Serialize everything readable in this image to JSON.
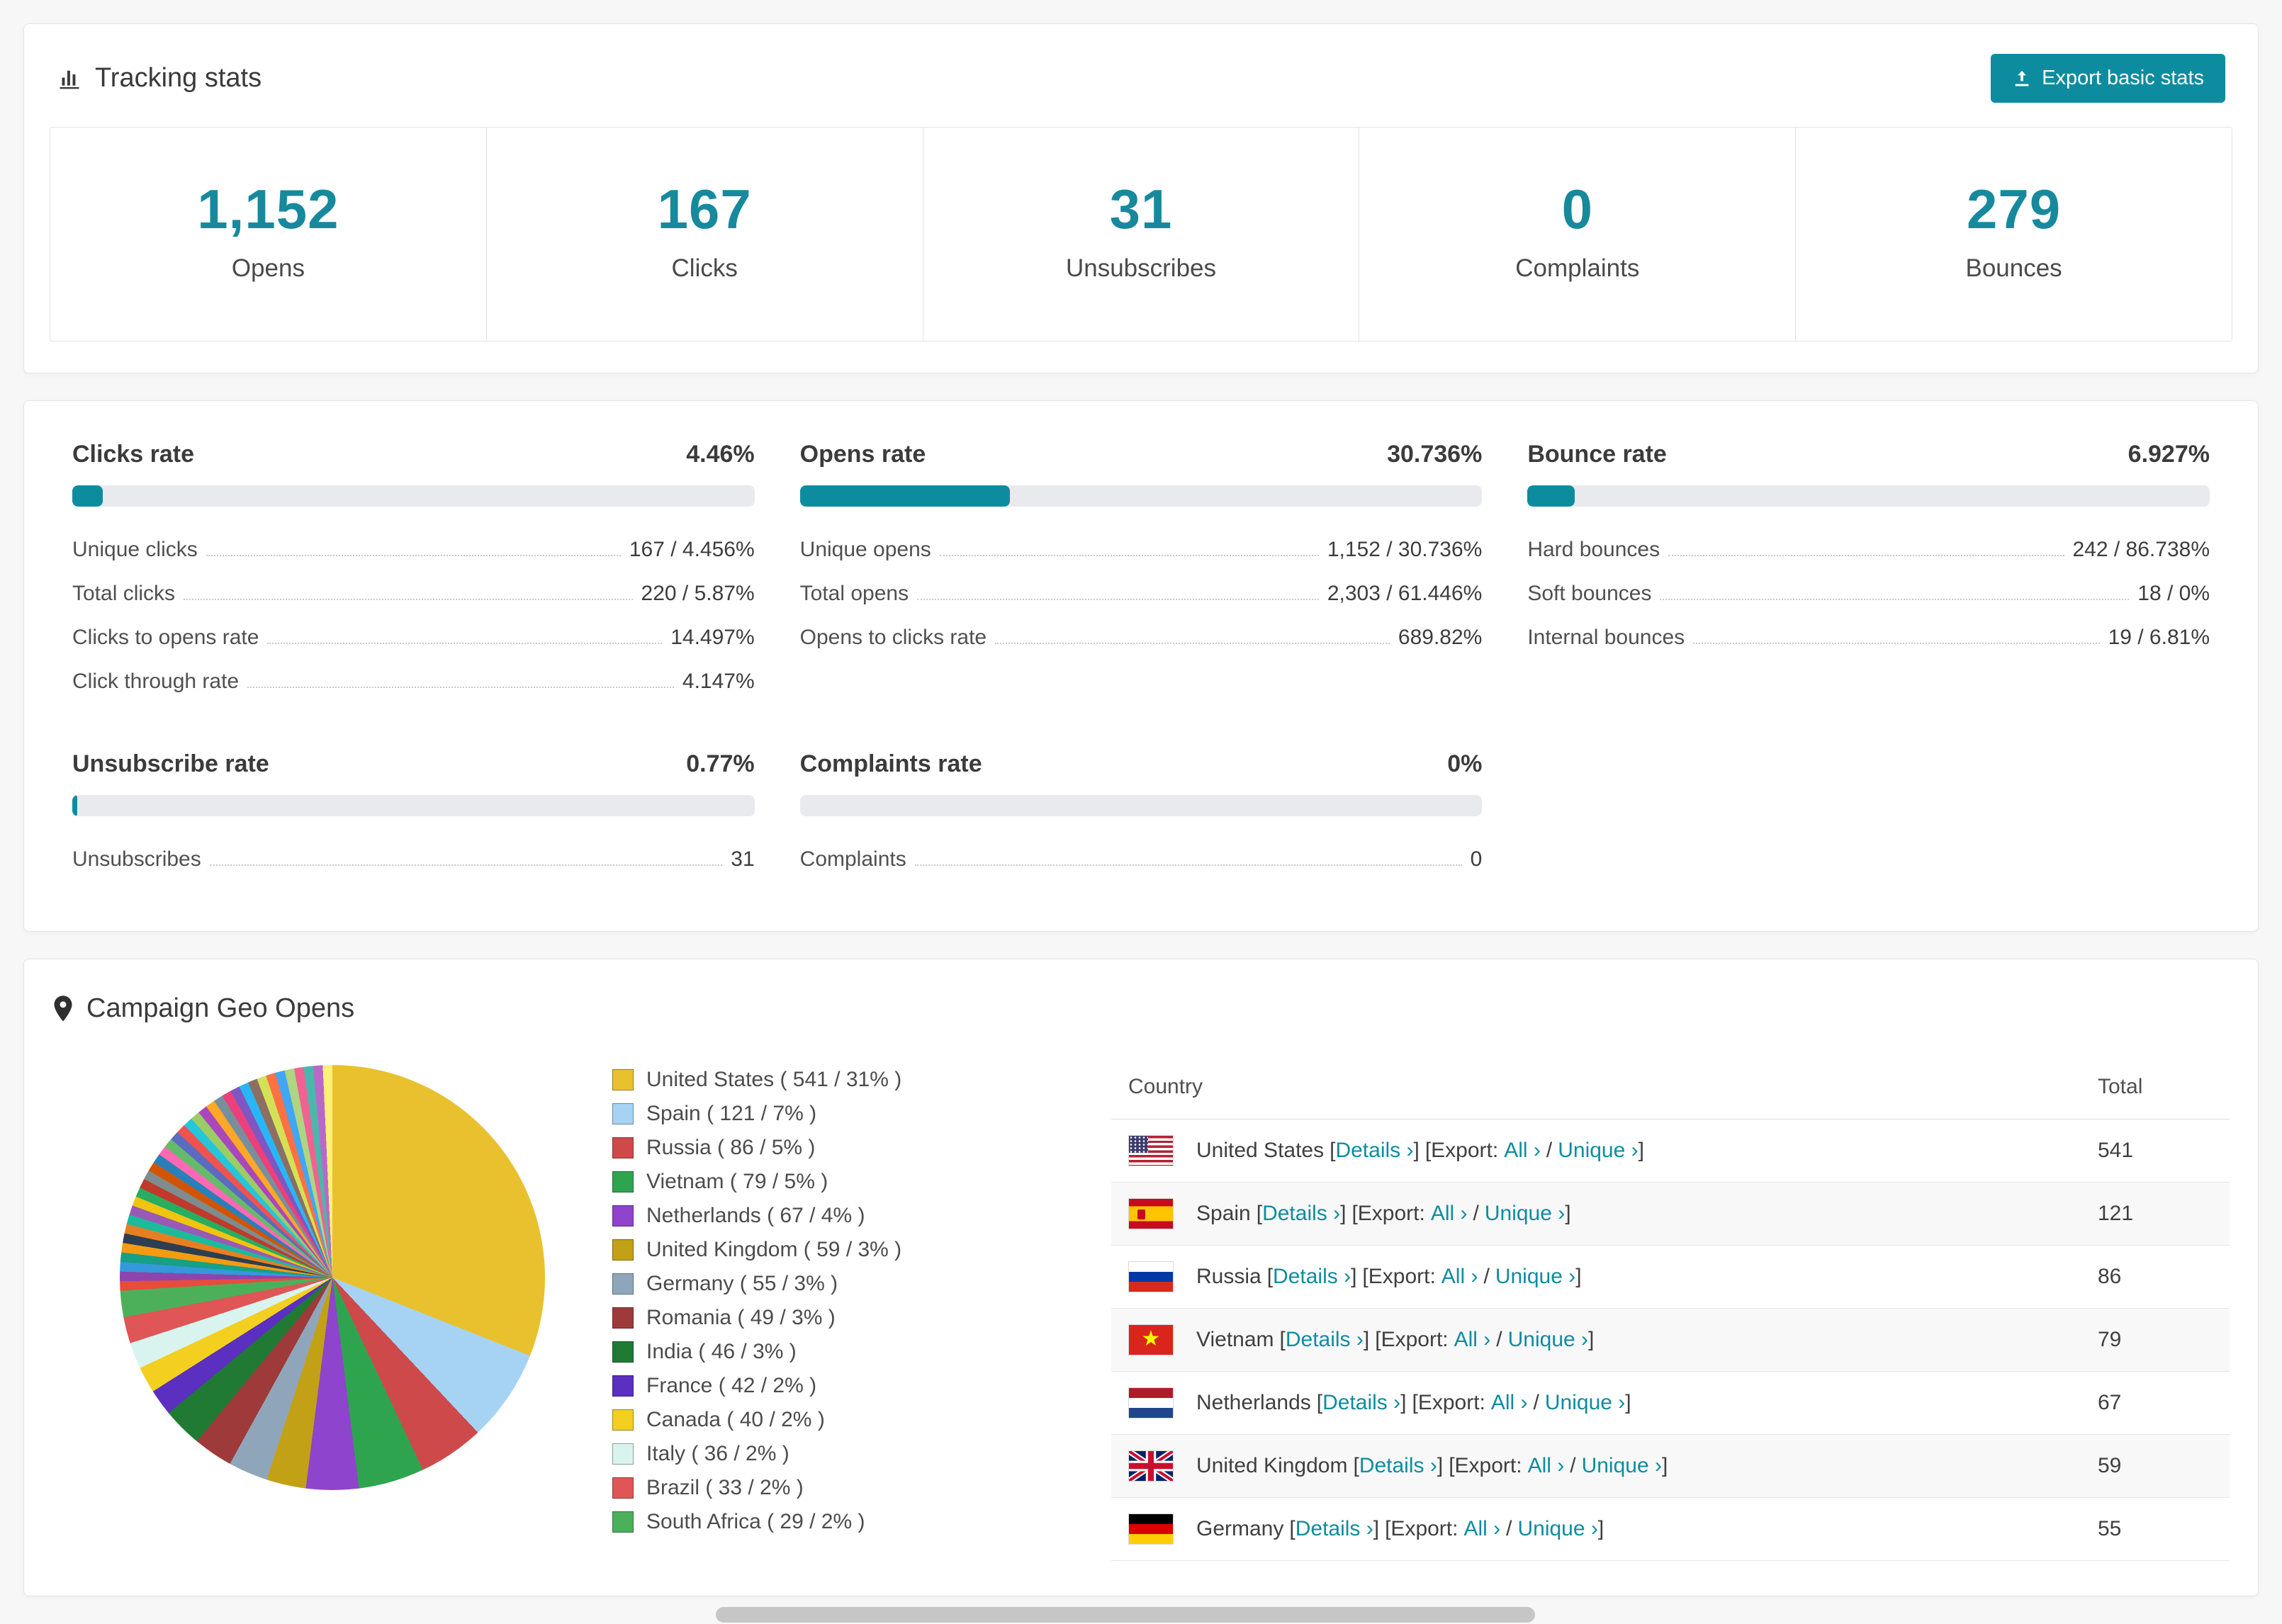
{
  "accent_color": "#0e8c9f",
  "tracking": {
    "title": "Tracking stats",
    "export_button": "Export basic stats",
    "stats": [
      {
        "value": "1,152",
        "label": "Opens"
      },
      {
        "value": "167",
        "label": "Clicks"
      },
      {
        "value": "31",
        "label": "Unsubscribes"
      },
      {
        "value": "0",
        "label": "Complaints"
      },
      {
        "value": "279",
        "label": "Bounces"
      }
    ]
  },
  "rates": [
    {
      "title": "Clicks rate",
      "value": "4.46%",
      "percent": 4.46,
      "rows": [
        {
          "label": "Unique clicks",
          "value": "167 / 4.456%"
        },
        {
          "label": "Total clicks",
          "value": "220 / 5.87%"
        },
        {
          "label": "Clicks to opens rate",
          "value": "14.497%"
        },
        {
          "label": "Click through rate",
          "value": "4.147%"
        }
      ]
    },
    {
      "title": "Opens rate",
      "value": "30.736%",
      "percent": 30.736,
      "rows": [
        {
          "label": "Unique opens",
          "value": "1,152 / 30.736%"
        },
        {
          "label": "Total opens",
          "value": "2,303 / 61.446%"
        },
        {
          "label": "Opens to clicks rate",
          "value": "689.82%"
        }
      ]
    },
    {
      "title": "Bounce rate",
      "value": "6.927%",
      "percent": 6.927,
      "rows": [
        {
          "label": "Hard bounces",
          "value": "242 / 86.738%"
        },
        {
          "label": "Soft bounces",
          "value": "18 / 0%"
        },
        {
          "label": "Internal bounces",
          "value": "19 / 6.81%"
        }
      ]
    },
    {
      "title": "Unsubscribe rate",
      "value": "0.77%",
      "percent": 0.77,
      "rows": [
        {
          "label": "Unsubscribes",
          "value": "31"
        }
      ]
    },
    {
      "title": "Complaints rate",
      "value": "0%",
      "percent": 0,
      "rows": [
        {
          "label": "Complaints",
          "value": "0"
        }
      ]
    }
  ],
  "geo": {
    "title": "Campaign Geo Opens",
    "table": {
      "headers": {
        "country": "Country",
        "total": "Total"
      },
      "labels": {
        "lb": "[",
        "rb": "]",
        "details": "Details ›",
        "export": "[Export:",
        "all": "All ›",
        "slash": "/",
        "unique": "Unique ›"
      },
      "rows": [
        {
          "country": "United States",
          "total": "541"
        },
        {
          "country": "Spain",
          "total": "121"
        },
        {
          "country": "Russia",
          "total": "86"
        },
        {
          "country": "Vietnam",
          "total": "79"
        },
        {
          "country": "Netherlands",
          "total": "67"
        },
        {
          "country": "United Kingdom",
          "total": "59"
        },
        {
          "country": "Germany",
          "total": "55"
        }
      ]
    }
  },
  "chart_data": {
    "type": "pie",
    "title": "Campaign Geo Opens",
    "legend_position": "right",
    "slices": [
      {
        "label": "United States",
        "count": 541,
        "percent": 31,
        "color": "#e9c12e",
        "legend": "United States ( 541 / 31% )"
      },
      {
        "label": "Spain",
        "count": 121,
        "percent": 7,
        "color": "#a6d3f3",
        "legend": "Spain ( 121 / 7% )"
      },
      {
        "label": "Russia",
        "count": 86,
        "percent": 5,
        "color": "#ce4a4a",
        "legend": "Russia ( 86 / 5% )"
      },
      {
        "label": "Vietnam",
        "count": 79,
        "percent": 5,
        "color": "#2ea44f",
        "legend": "Vietnam ( 79 / 5% )"
      },
      {
        "label": "Netherlands",
        "count": 67,
        "percent": 4,
        "color": "#8e44cc",
        "legend": "Netherlands ( 67 / 4% )"
      },
      {
        "label": "United Kingdom",
        "count": 59,
        "percent": 3,
        "color": "#c3a117",
        "legend": "United Kingdom ( 59 / 3% )"
      },
      {
        "label": "Germany",
        "count": 55,
        "percent": 3,
        "color": "#8fa6ba",
        "legend": "Germany ( 55 / 3% )"
      },
      {
        "label": "Romania",
        "count": 49,
        "percent": 3,
        "color": "#9e3a3a",
        "legend": "Romania ( 49 / 3% )"
      },
      {
        "label": "India",
        "count": 46,
        "percent": 3,
        "color": "#217a34",
        "legend": "India ( 46 / 3% )"
      },
      {
        "label": "France",
        "count": 42,
        "percent": 2,
        "color": "#5b2fbf",
        "legend": "France ( 42 / 2% )"
      },
      {
        "label": "Canada",
        "count": 40,
        "percent": 2,
        "color": "#f3cf1f",
        "legend": "Canada ( 40 / 2% )"
      },
      {
        "label": "Italy",
        "count": 36,
        "percent": 2,
        "color": "#d9f4ef",
        "legend": "Italy ( 36 / 2% )"
      },
      {
        "label": "Brazil",
        "count": 33,
        "percent": 2,
        "color": "#e05555",
        "legend": "Brazil ( 33 / 2% )"
      },
      {
        "label": "South Africa",
        "count": 29,
        "percent": 2,
        "color": "#4cb05b",
        "legend": "South Africa ( 29 / 2% )"
      }
    ],
    "other_slice_count": 36,
    "other_palette": [
      "#e74c3c",
      "#8e44ad",
      "#3498db",
      "#16a085",
      "#f39c12",
      "#2c3e50",
      "#e67e22",
      "#1abc9c",
      "#9b59b6",
      "#f1c40f",
      "#27ae60",
      "#c0392b",
      "#7f8c8d",
      "#d35400",
      "#2980b9",
      "#ff69b4",
      "#66bb6a",
      "#5c6bc0",
      "#ef5350",
      "#26c6da",
      "#9ccc65",
      "#ab47bc",
      "#ffa726",
      "#78909c",
      "#ec407a",
      "#7e57c2",
      "#29b6f6",
      "#8d6e63",
      "#d4e157",
      "#ff7043",
      "#42a5f5",
      "#aed581",
      "#f06292",
      "#4db6ac",
      "#ba68c8",
      "#fff176"
    ]
  }
}
